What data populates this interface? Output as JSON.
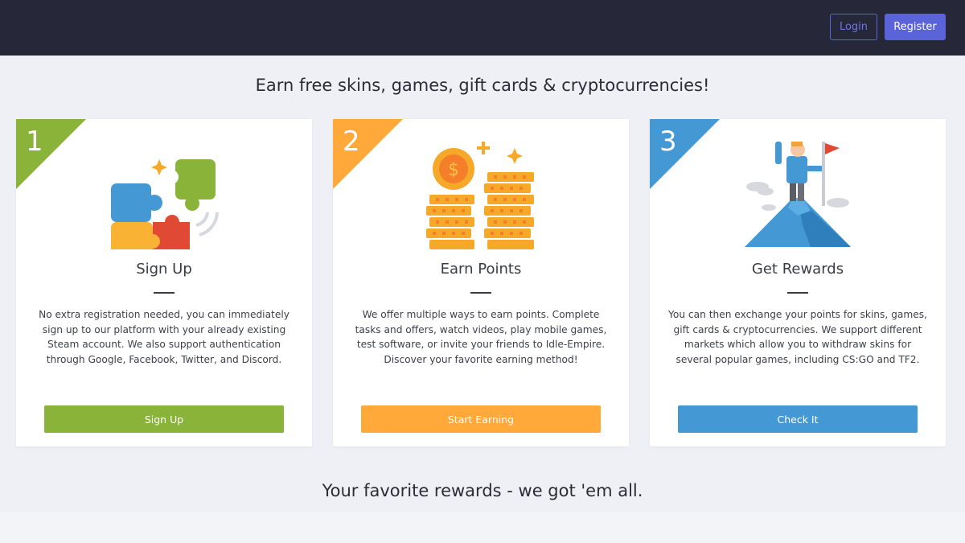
{
  "header": {
    "login_label": "Login",
    "register_label": "Register"
  },
  "headline": "Earn free skins, games, gift cards & cryptocurrencies!",
  "cards": [
    {
      "number": "1",
      "title": "Sign Up",
      "description": "No extra registration needed, you can immediately sign up to our platform with your already existing Steam account. We also support authentication through Google, Facebook, Twitter, and Discord.",
      "button_label": "Sign Up",
      "accent": "#8ab33a",
      "icon": "puzzle-icon"
    },
    {
      "number": "2",
      "title": "Earn Points",
      "description": "We offer multiple ways to earn points. Complete tasks and offers, watch videos, play mobile games, test software, or invite your friends to Idle-Empire. Discover your favorite earning method!",
      "button_label": "Start Earning",
      "accent": "#ffa93b",
      "icon": "coins-icon"
    },
    {
      "number": "3",
      "title": "Get Rewards",
      "description": "You can then exchange your points for skins, games, gift cards & cryptocurrencies. We support different markets which allow you to withdraw skins for several popular games, including CS:GO and TF2.",
      "button_label": "Check It",
      "accent": "#4499d4",
      "icon": "mountain-flag-icon"
    }
  ],
  "subheadline": "Your favorite rewards - we got 'em all."
}
